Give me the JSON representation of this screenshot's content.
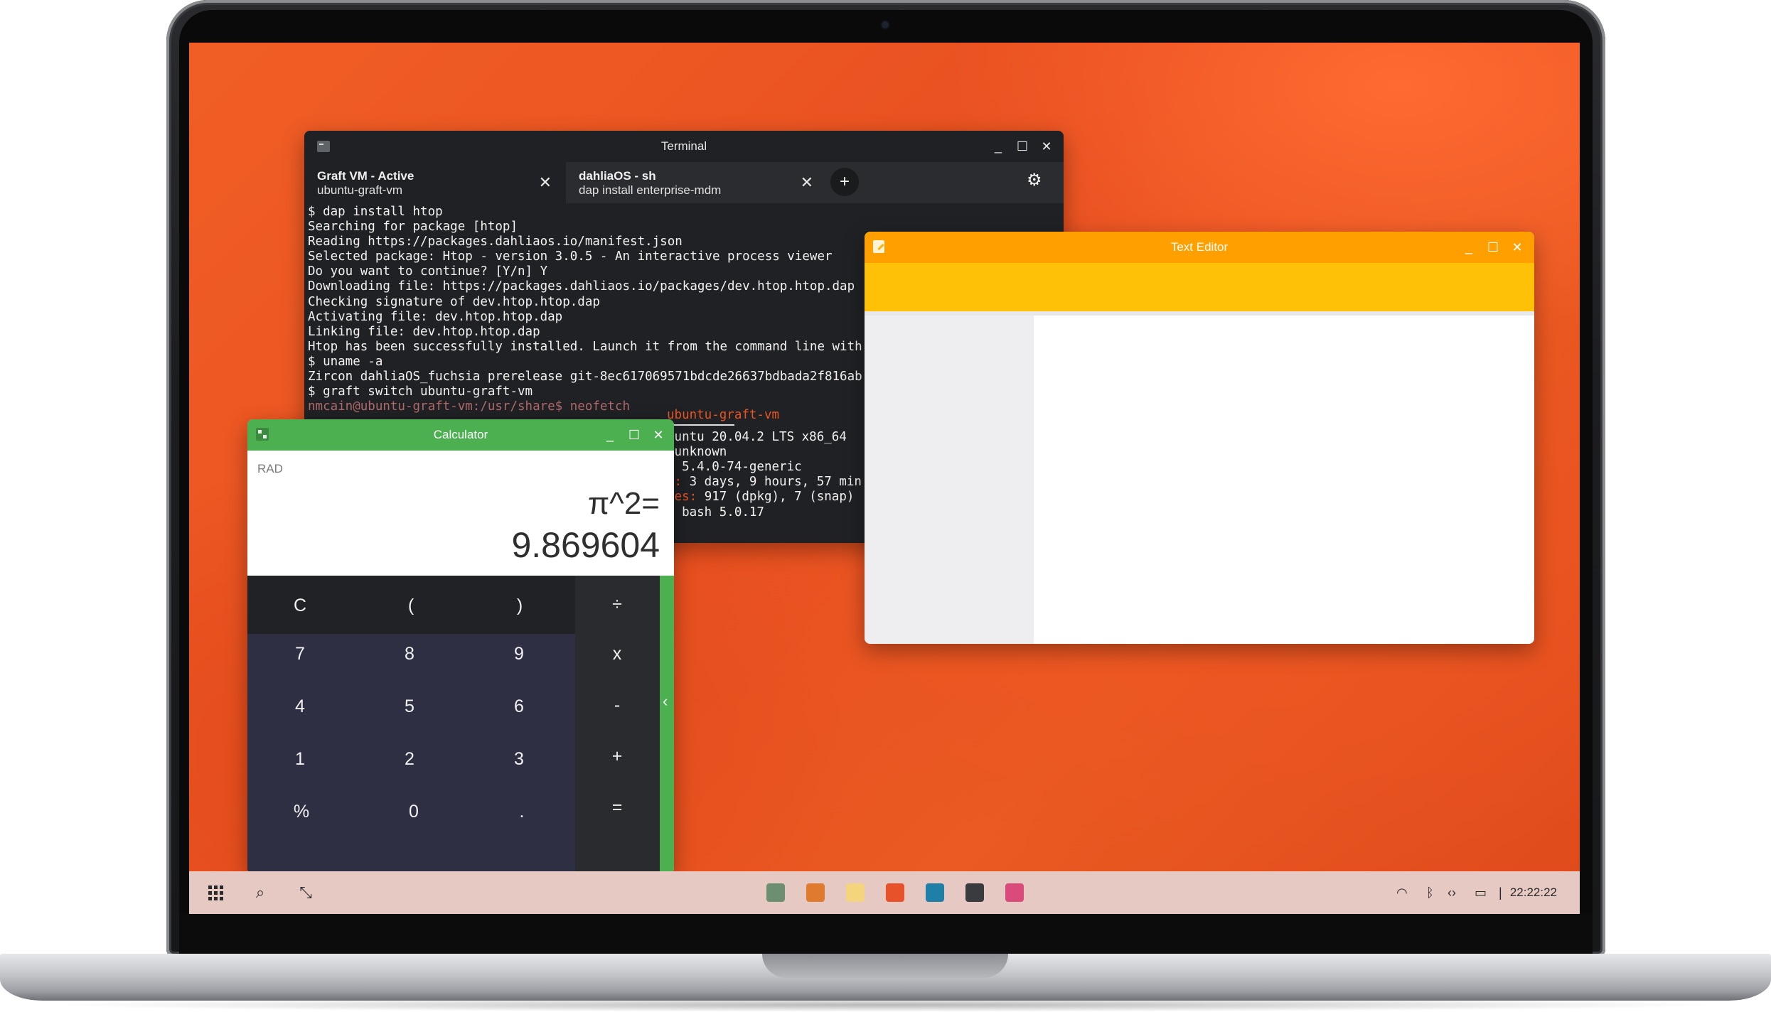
{
  "terminal": {
    "title": "Terminal",
    "tabs": [
      {
        "title": "Graft VM - Active",
        "subtitle": "ubuntu-graft-vm"
      },
      {
        "title": "dahliaOS - sh",
        "subtitle": "dap install enterprise-mdm"
      }
    ],
    "lines": [
      "$ dap install htop",
      "Searching for package [htop]",
      "Reading https://packages.dahliaos.io/manifest.json",
      "Selected package: Htop - version 3.0.5 - An interactive process viewer",
      "Do you want to continue? [Y/n] Y",
      "Downloading file: https://packages.dahliaos.io/packages/dev.htop.htop.dap",
      "Checking signature of dev.htop.htop.dap",
      "Activating file: dev.htop.htop.dap",
      "Linking file: dev.htop.htop.dap",
      "Htop has been successfully installed. Launch it from the command line with",
      "$ uname -a",
      "Zircon dahliaOS_fuchsia prerelease git-8ec617069571bdcde26637bdbada2f816ab",
      "$ graft switch ubuntu-graft-vm",
      "nmcain@ubuntu-graft-vm:/usr/share$ neofetch"
    ],
    "neofetch": {
      "header": "ubuntu-graft-vm",
      "rows": [
        {
          "label": "",
          "value": "buntu 20.04.2 LTS x86_64"
        },
        {
          "label": "",
          "value": " unknown"
        },
        {
          "label": ": ",
          "value": "5.4.0-74-generic"
        },
        {
          "label": "e: ",
          "value": "3 days, 9 hours, 57 min"
        },
        {
          "label": "ges: ",
          "value": "917 (dpkg), 7 (snap)"
        },
        {
          "label": ": ",
          "value": "bash 5.0.17"
        }
      ]
    }
  },
  "calculator": {
    "title": "Calculator",
    "mode": "RAD",
    "expression": "π^2=",
    "result": "9.869604",
    "keys": {
      "clear": "C",
      "lparen": "(",
      "rparen": ")",
      "divide": "÷",
      "seven": "7",
      "eight": "8",
      "nine": "9",
      "multiply": "x",
      "four": "4",
      "five": "5",
      "six": "6",
      "minus": "-",
      "one": "1",
      "two": "2",
      "three": "3",
      "plus": "+",
      "percent": "%",
      "zero": "0",
      "dot": ".",
      "equals": "="
    },
    "edge_arrow": "‹"
  },
  "editor": {
    "title": "Text Editor"
  },
  "window_controls": {
    "minimize": "_",
    "maximize": "☐",
    "close": "✕"
  },
  "terminal_tab_close": "✕",
  "terminal_tab_add": "+",
  "terminal_settings": "⚙",
  "taskbar": {
    "search": "⌕",
    "minimize_all": "⤡",
    "clock": "22:22:22",
    "tray": {
      "wifi": "◠",
      "bluetooth": "ᛒ",
      "code": "‹›",
      "battery": "▭",
      "separator": "|"
    },
    "apps": [
      {
        "name": "calculator",
        "color": "#6d8f71"
      },
      {
        "name": "files",
        "color": "#e07a2e"
      },
      {
        "name": "text-editor",
        "color": "#f4d47c"
      },
      {
        "name": "settings",
        "color": "#e8522a"
      },
      {
        "name": "media",
        "color": "#1f7fa6"
      },
      {
        "name": "terminal",
        "color": "#3a3b3e"
      },
      {
        "name": "web-browser",
        "color": "#d94b7b"
      }
    ]
  }
}
